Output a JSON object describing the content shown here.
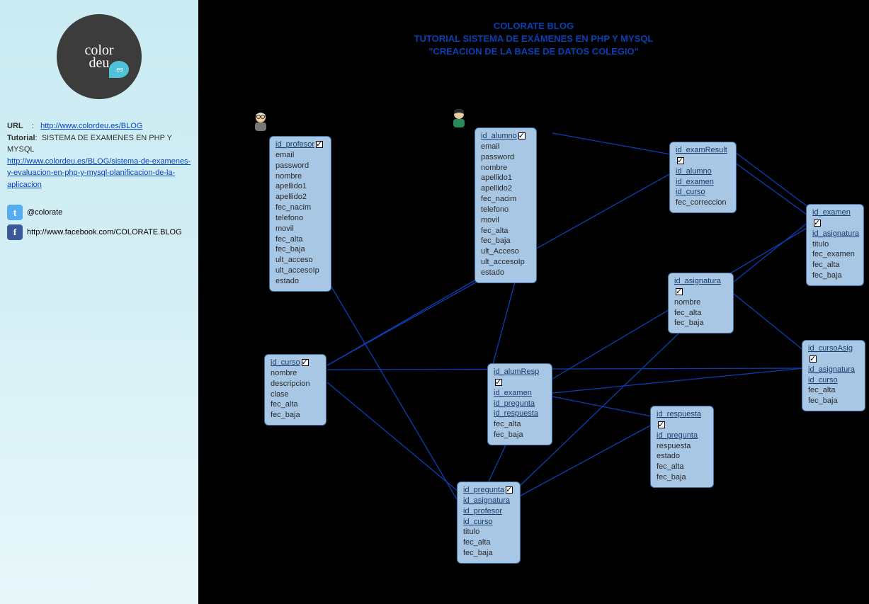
{
  "sidebar": {
    "logo_text1": "color",
    "logo_text2": "deu",
    "logo_bubble": ".es",
    "url_label": "URL",
    "url_sep": ":",
    "url": "http://www.colordeu.es/BLOG",
    "tutorial_label": "Tutorial",
    "tutorial_sep": ":",
    "tutorial_title": "SISTEMA DE EXAMENES EN PHP Y MYSQL",
    "tutorial_link": "http://www.colordeu.es/BLOG/sistema-de-examenes-y-evaluacion-en-php-y-mysql-planificacion-de-la-aplicacion",
    "twitter": "@colorate",
    "facebook": "http://www.facebook.com/COLORATE.BLOG"
  },
  "title": {
    "line1": "COLORATE BLOG",
    "line2": "TUTORIAL SISTEMA DE EXÁMENES EN PHP Y MYSQL",
    "line3": "\"CREACION DE LA BASE DE DATOS COLEGIO\""
  },
  "entities": {
    "profesor": {
      "pk": "id_profesor",
      "fields": [
        "email",
        "password",
        "nombre",
        "apellido1",
        "apellido2",
        "fec_nacim",
        "telefono",
        "movil",
        "fec_alta",
        "fec_baja",
        "ult_acceso",
        "ult_accesoIp",
        "estado"
      ]
    },
    "alumno": {
      "pk": "id_alumno",
      "fields": [
        "email",
        "password",
        "nombre",
        "apellido1",
        "apellido2",
        "fec_nacim",
        "telefono",
        "movil",
        "fec_alta",
        "fec_baja",
        "ult_Acceso",
        "ult_accesoIp",
        "estado"
      ]
    },
    "curso": {
      "pk": "id_curso",
      "fields": [
        "nombre",
        "descripcion",
        "clase",
        "fec_alta",
        "fec_baja"
      ]
    },
    "examResult": {
      "pk": "id_examResult",
      "fks": [
        "id_alumno",
        "id_examen",
        "id_curso"
      ],
      "fields": [
        "fec_correccion"
      ]
    },
    "examen": {
      "pk": "id_examen",
      "fks": [
        "id_asignatura"
      ],
      "fields": [
        "titulo",
        "fec_examen",
        "fec_alta",
        "fec_baja"
      ]
    },
    "asignatura": {
      "pk": "id_asignatura",
      "fields": [
        "nombre",
        "fec_alta",
        "fec_baja"
      ]
    },
    "cursoAsig": {
      "pk": "id_cursoAsig",
      "fks": [
        "id_asignatura",
        "id_curso"
      ],
      "fields": [
        "fec_alta",
        "fec_baja"
      ]
    },
    "alumResp": {
      "pk": "id_alumResp",
      "fks": [
        "id_examen",
        "id_pregunta",
        "id_respuesta"
      ],
      "fields": [
        "fec_alta",
        "fec_baja"
      ]
    },
    "respuesta": {
      "pk": "id_respuesta",
      "fks": [
        "id_pregunta"
      ],
      "fields": [
        "respuesta",
        "estado",
        "fec_alta",
        "fec_baja"
      ]
    },
    "pregunta": {
      "pk": "id_pregunta",
      "fks": [
        "id_asignatura",
        "id_profesor",
        "id_curso"
      ],
      "fields": [
        "titulo",
        "fec_alta",
        "fec_baja"
      ]
    }
  }
}
